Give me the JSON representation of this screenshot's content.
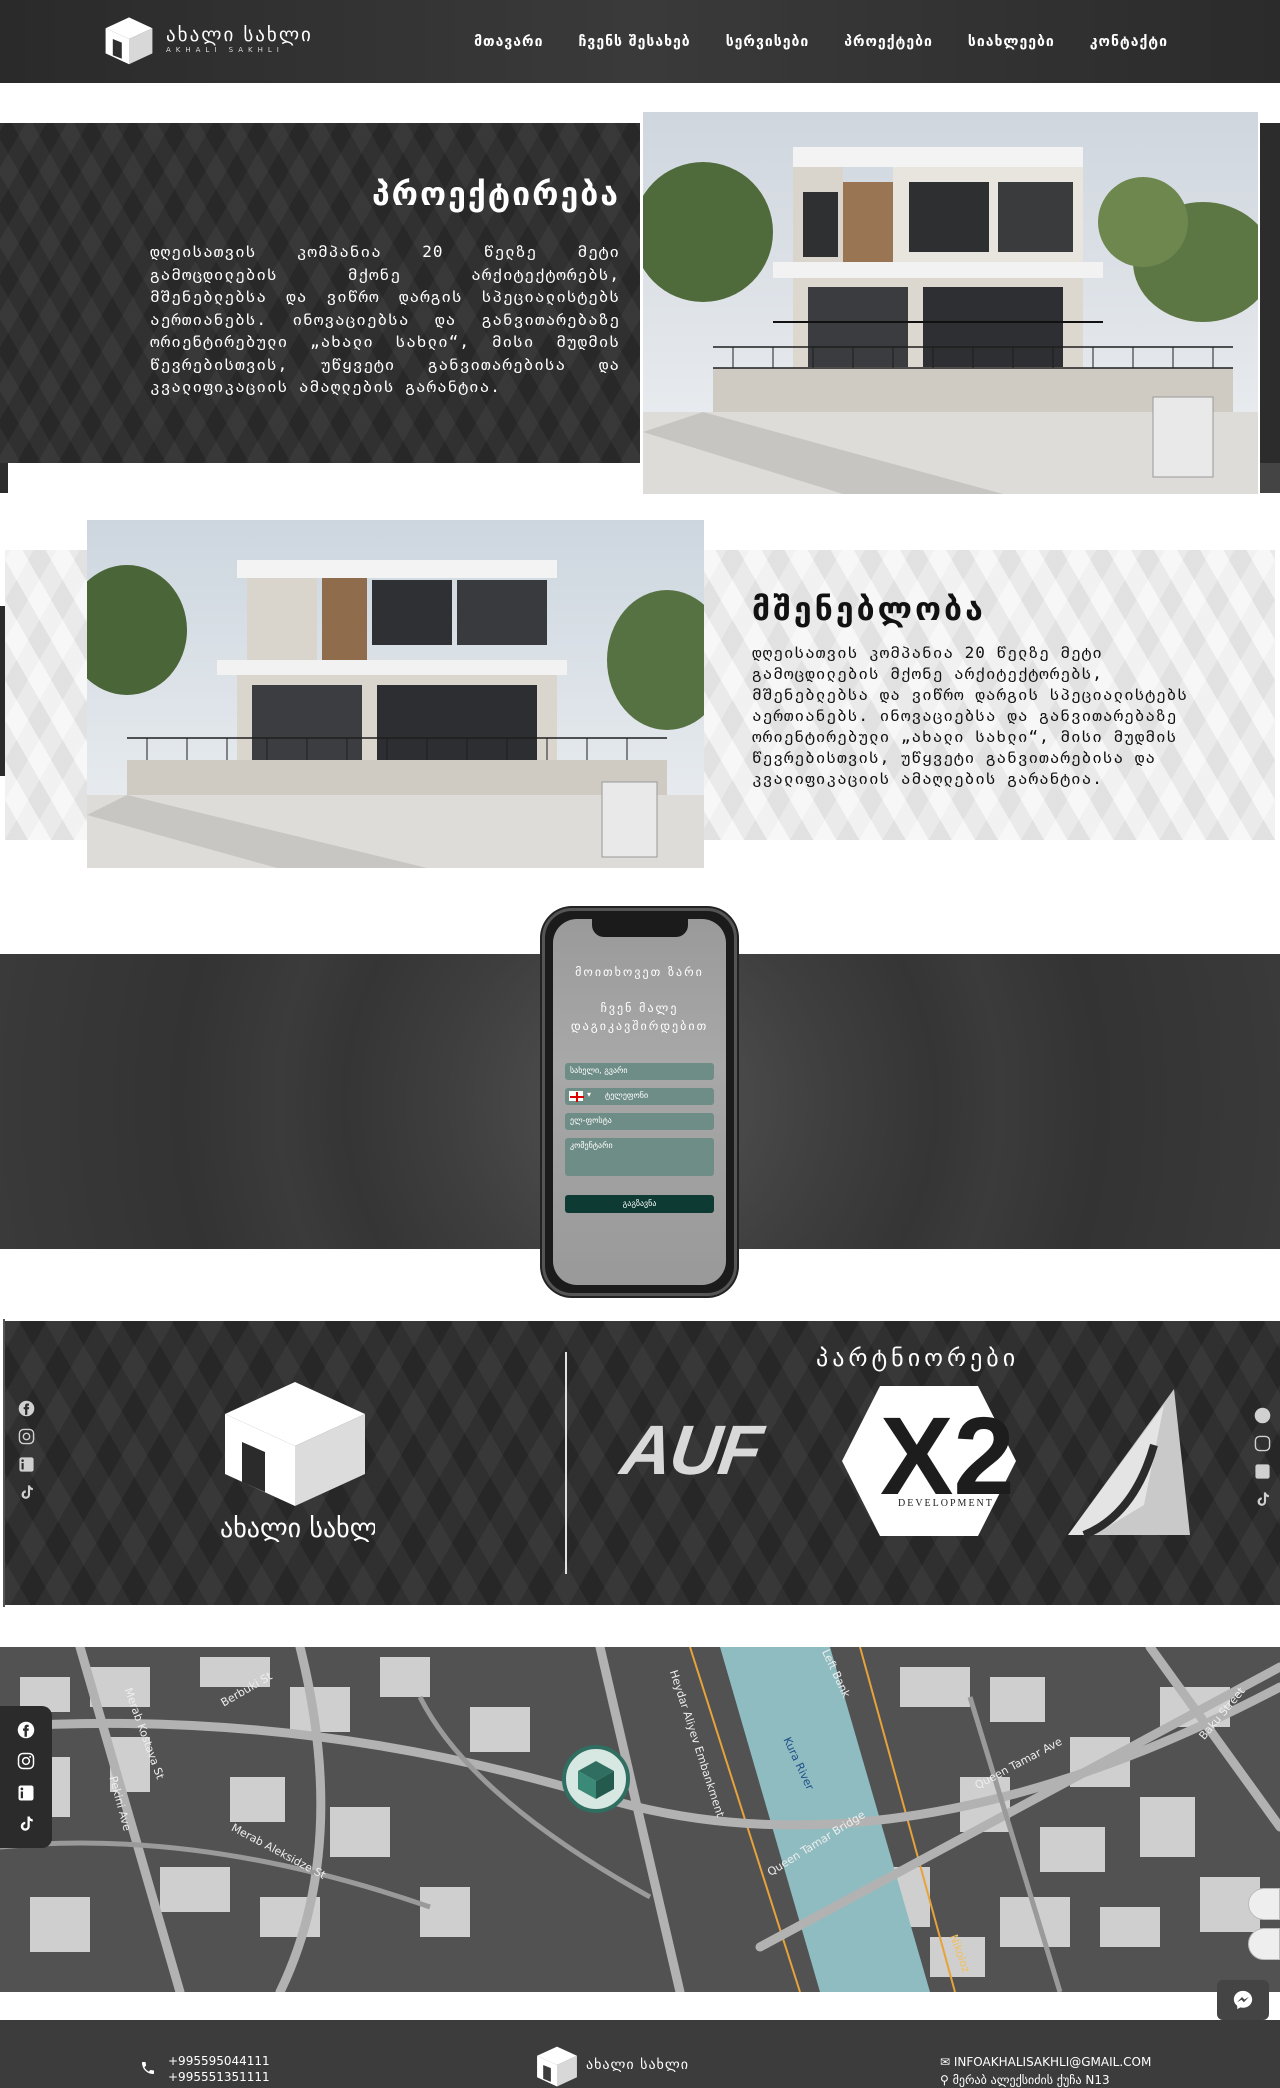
{
  "brand": {
    "name": "ახალი სახლი",
    "subname": "AKHALI SAKHLI"
  },
  "nav": {
    "items": [
      {
        "label": "მთავარი"
      },
      {
        "label": "ჩვენს შესახებ"
      },
      {
        "label": "სერვისები"
      },
      {
        "label": "პროექტები"
      },
      {
        "label": "სიახლეები"
      },
      {
        "label": "კონტაქტი"
      }
    ]
  },
  "design": {
    "title": "პროექტირება",
    "text": "დღეისათვის კომპანია 20 წელზე მეტი გამოცდილების მქონე არქიტექტორებს, მშენებლებსა და ვიწრო დარგის სპეციალისტებს აერთიანებს. ინოვაციებსა და განვითარებაზე ორიენტირებული „ახალი სახლი“, მისი მუდმის წევრებისთვის, უწყვეტი განვითარებისა და კვალიფიკაციის ამაღლების გარანტია."
  },
  "construction": {
    "title": "მშენებლობა",
    "text": "დღეისათვის კომპანია 20 წელზე მეტი გამოცდილების მქონე არქიტექტორებს, მშენებლებსა და ვიწრო დარგის სპეციალისტებს აერთიანებს. ინოვაციებსა და განვითარებაზე ორიენტირებული „ახალი სახლი“, მისი მუდმის წევრებისთვის, უწყვეტი განვითარებისა და კვალიფიკაციის ამაღლების გარანტია."
  },
  "contact_form": {
    "title": "მოითხოვეთ ზარი",
    "subtitle": "ჩვენ მალე დაგიკავშირდებით",
    "name_placeholder": "სახელი, გვარი",
    "phone_placeholder": "ტელეფონი",
    "email_placeholder": "ელ-ფოსტა",
    "comment_placeholder": "კომენტარი",
    "submit_label": "გაგზავნა"
  },
  "partners": {
    "title": "პარტნიორები",
    "items": [
      {
        "name": "AUF"
      },
      {
        "name": "X2",
        "sub": "DEVELOPMENT"
      },
      {
        "name": "sail-logo"
      }
    ]
  },
  "map": {
    "labels": [
      "Merab Kostava St",
      "Berbuki St",
      "Pekini Ave",
      "Merab Aleksidze St",
      "Queen Tamar Bridge",
      "Queen Tamar Ave",
      "Kura River",
      "Left Bank",
      "Heydar Aliyev Embankment",
      "Baku Street",
      "Nikoloz"
    ]
  },
  "footer": {
    "phones": [
      "+995595044111",
      "+995551351111"
    ],
    "email": "INFOAKHALISAKHLI@GMAIL.COM",
    "address": "მერაბ ალექსიძის ქუჩა N13"
  },
  "social": [
    "facebook-icon",
    "instagram-icon",
    "linkedin-icon",
    "tiktok-icon"
  ],
  "colors": {
    "dark": "#2c2c2c",
    "form_field": "#6e8d86",
    "form_button": "#0d3a33",
    "river": "#8fbcc0"
  }
}
